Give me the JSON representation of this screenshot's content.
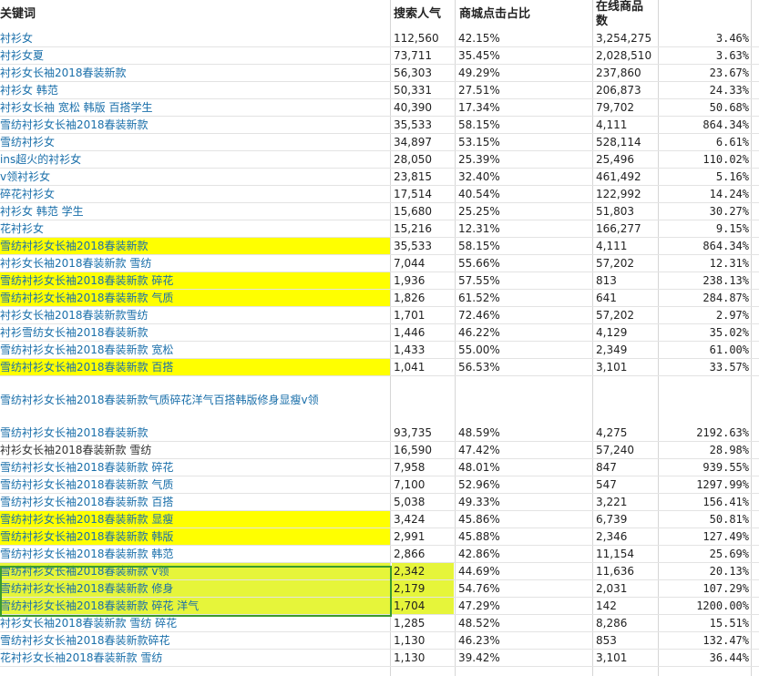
{
  "header": {
    "keyword": "关键词",
    "search": "搜索人气",
    "click": "商城点击占比",
    "online": "在线商品",
    "online2": "数"
  },
  "rows1": [
    {
      "kw": "衬衫女",
      "s": "112,560",
      "c": "42.15%",
      "o": "3,254,275",
      "r": "3.46%",
      "hl": false
    },
    {
      "kw": "衬衫女夏",
      "s": "73,711",
      "c": "35.45%",
      "o": "2,028,510",
      "r": "3.63%",
      "hl": false
    },
    {
      "kw": "衬衫女长袖2018春装新款",
      "s": "56,303",
      "c": "49.29%",
      "o": "237,860",
      "r": "23.67%",
      "hl": false
    },
    {
      "kw": "衬衫女 韩范",
      "s": "50,331",
      "c": "27.51%",
      "o": "206,873",
      "r": "24.33%",
      "hl": false
    },
    {
      "kw": "衬衫女长袖 宽松 韩版 百搭学生",
      "s": "40,390",
      "c": "17.34%",
      "o": "79,702",
      "r": "50.68%",
      "hl": false
    },
    {
      "kw": "雪纺衬衫女长袖2018春装新款",
      "s": "35,533",
      "c": "58.15%",
      "o": "4,111",
      "r": "864.34%",
      "hl": false
    },
    {
      "kw": "雪纺衬衫女",
      "s": "34,897",
      "c": "53.15%",
      "o": "528,114",
      "r": "6.61%",
      "hl": false
    },
    {
      "kw": "ins超火的衬衫女",
      "s": "28,050",
      "c": "25.39%",
      "o": "25,496",
      "r": "110.02%",
      "hl": false
    },
    {
      "kw": "v领衬衫女",
      "s": "23,815",
      "c": "32.40%",
      "o": "461,492",
      "r": "5.16%",
      "hl": false
    },
    {
      "kw": "碎花衬衫女",
      "s": "17,514",
      "c": "40.54%",
      "o": "122,992",
      "r": "14.24%",
      "hl": false
    },
    {
      "kw": "衬衫女 韩范 学生",
      "s": "15,680",
      "c": "25.25%",
      "o": "51,803",
      "r": "30.27%",
      "hl": false
    },
    {
      "kw": "花衬衫女",
      "s": "15,216",
      "c": "12.31%",
      "o": "166,277",
      "r": "9.15%",
      "hl": false
    },
    {
      "kw": "雪纺衬衫女长袖2018春装新款",
      "s": "35,533",
      "c": "58.15%",
      "o": "4,111",
      "r": "864.34%",
      "hl": true
    },
    {
      "kw": "衬衫女长袖2018春装新款 雪纺",
      "s": "7,044",
      "c": "55.66%",
      "o": "57,202",
      "r": "12.31%",
      "hl": false
    },
    {
      "kw": "雪纺衬衫女长袖2018春装新款 碎花",
      "s": "1,936",
      "c": "57.55%",
      "o": "813",
      "r": "238.13%",
      "hl": true
    },
    {
      "kw": "雪纺衬衫女长袖2018春装新款 气质",
      "s": "1,826",
      "c": "61.52%",
      "o": "641",
      "r": "284.87%",
      "hl": true
    },
    {
      "kw": "衬衫女长袖2018春装新款雪纺",
      "s": "1,701",
      "c": "72.46%",
      "o": "57,202",
      "r": "2.97%",
      "hl": false
    },
    {
      "kw": "衬衫雪纺女长袖2018春装新款",
      "s": "1,446",
      "c": "46.22%",
      "o": "4,129",
      "r": "35.02%",
      "hl": false
    },
    {
      "kw": "雪纺衬衫女长袖2018春装新款 宽松",
      "s": "1,433",
      "c": "55.00%",
      "o": "2,349",
      "r": "61.00%",
      "hl": false
    },
    {
      "kw": "雪纺衬衫女长袖2018春装新款 百搭",
      "s": "1,041",
      "c": "56.53%",
      "o": "3,101",
      "r": "33.57%",
      "hl": true
    }
  ],
  "note": "雪纺衬衫女长袖2018春装新款气质碎花洋气百搭韩版修身显瘦v领",
  "rows2": [
    {
      "kw": "雪纺衬衫女长袖2018春装新款",
      "s": "93,735",
      "c": "48.59%",
      "o": "4,275",
      "r": "2192.63%",
      "hl": false,
      "dark": false
    },
    {
      "kw": "衬衫女长袖2018春装新款 雪纺",
      "s": "16,590",
      "c": "47.42%",
      "o": "57,240",
      "r": "28.98%",
      "hl": false,
      "dark": true
    },
    {
      "kw": "雪纺衬衫女长袖2018春装新款 碎花",
      "s": "7,958",
      "c": "48.01%",
      "o": "847",
      "r": "939.55%",
      "hl": false,
      "dark": false
    },
    {
      "kw": "雪纺衬衫女长袖2018春装新款 气质",
      "s": "7,100",
      "c": "52.96%",
      "o": "547",
      "r": "1297.99%",
      "hl": false,
      "dark": false
    },
    {
      "kw": "雪纺衬衫女长袖2018春装新款 百搭",
      "s": "5,038",
      "c": "49.33%",
      "o": "3,221",
      "r": "156.41%",
      "hl": false,
      "dark": false
    },
    {
      "kw": "雪纺衬衫女长袖2018春装新款 显瘦",
      "s": "3,424",
      "c": "45.86%",
      "o": "6,739",
      "r": "50.81%",
      "hl": true,
      "dark": false
    },
    {
      "kw": "雪纺衬衫女长袖2018春装新款 韩版",
      "s": "2,991",
      "c": "45.88%",
      "o": "2,346",
      "r": "127.49%",
      "hl": true,
      "dark": false
    },
    {
      "kw": "雪纺衬衫女长袖2018春装新款 韩范",
      "s": "2,866",
      "c": "42.86%",
      "o": "11,154",
      "r": "25.69%",
      "hl": false,
      "dark": false
    },
    {
      "kw": "雪纺衬衫女长袖2018春装新款 v领",
      "s": "2,342",
      "c": "44.69%",
      "o": "11,636",
      "r": "20.13%",
      "green": true,
      "dark": false
    },
    {
      "kw": "雪纺衬衫女长袖2018春装新款 修身",
      "s": "2,179",
      "c": "54.76%",
      "o": "2,031",
      "r": "107.29%",
      "green": true,
      "dark": false
    },
    {
      "kw": "雪纺衬衫女长袖2018春装新款 碎花 洋气",
      "s": "1,704",
      "c": "47.29%",
      "o": "142",
      "r": "1200.00%",
      "green": true,
      "dark": false
    },
    {
      "kw": "衬衫女长袖2018春装新款 雪纺 碎花",
      "s": "1,285",
      "c": "48.52%",
      "o": "8,286",
      "r": "15.51%",
      "hl": false,
      "dark": false
    },
    {
      "kw": "雪纺衬衫女长袖2018春装新款碎花",
      "s": "1,130",
      "c": "46.23%",
      "o": "853",
      "r": "132.47%",
      "hl": false,
      "dark": false
    },
    {
      "kw": "花衬衫女长袖2018春装新款 雪纺",
      "s": "1,130",
      "c": "39.42%",
      "o": "3,101",
      "r": "36.44%",
      "hl": false,
      "dark": false
    }
  ]
}
